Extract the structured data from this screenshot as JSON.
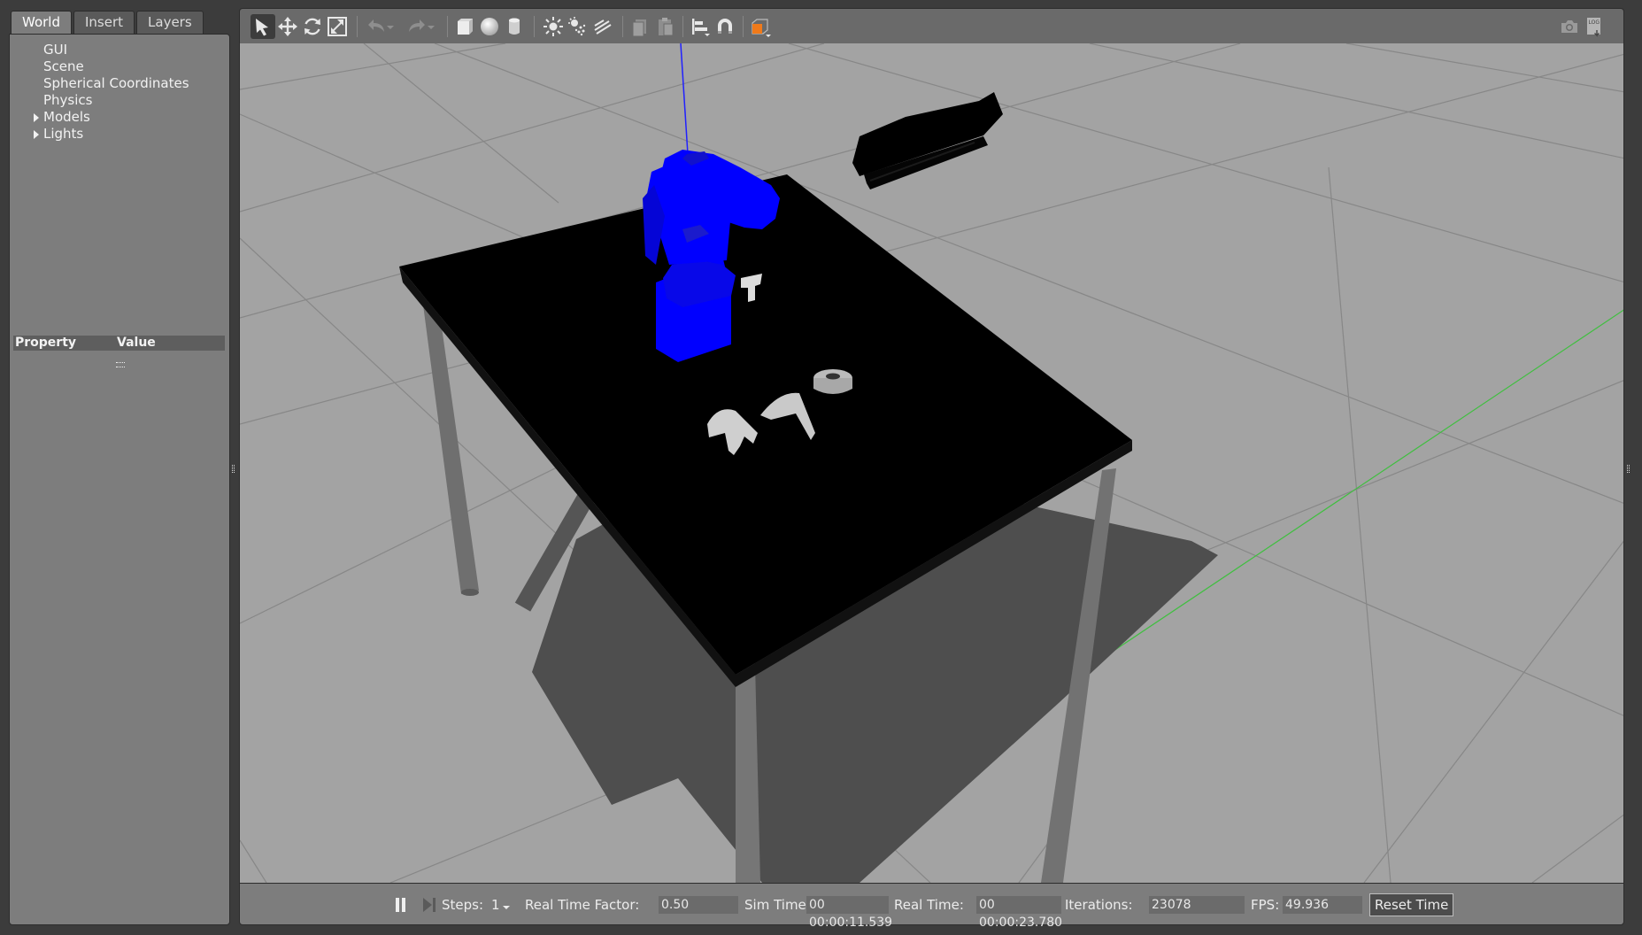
{
  "left_panel": {
    "tabs": [
      "World",
      "Insert",
      "Layers"
    ],
    "active_tab": "World",
    "tree": [
      {
        "label": "GUI",
        "expandable": false
      },
      {
        "label": "Scene",
        "expandable": false
      },
      {
        "label": "Spherical Coordinates",
        "expandable": false
      },
      {
        "label": "Physics",
        "expandable": false
      },
      {
        "label": "Models",
        "expandable": true
      },
      {
        "label": "Lights",
        "expandable": true
      }
    ],
    "properties": {
      "col_property": "Property",
      "col_value": "Value"
    }
  },
  "toolbar": {
    "icons": [
      "select-arrow-icon",
      "translate-icon",
      "rotate-icon",
      "scale-icon",
      "undo-icon",
      "undo-history-icon",
      "redo-icon",
      "redo-history-icon",
      "box-shape-icon",
      "sphere-shape-icon",
      "cylinder-shape-icon",
      "point-light-icon",
      "spot-light-icon",
      "directional-light-icon",
      "copy-icon",
      "paste-icon",
      "align-icon",
      "magnet-snap-icon",
      "view-angle-icon",
      "screenshot-icon",
      "log-icon"
    ],
    "active": "select-arrow-icon"
  },
  "bottom_bar": {
    "steps_label": "Steps:",
    "steps_value": "1",
    "rtf_label": "Real Time Factor:",
    "rtf_value": "0.50",
    "sim_time_label": "Sim Time:",
    "sim_time_value": "00 00:00:11.539",
    "real_time_label": "Real Time:",
    "real_time_value": "00 00:00:23.780",
    "iterations_label": "Iterations:",
    "iterations_value": "23078",
    "fps_label": "FPS:",
    "fps_value": "49.936",
    "reset_label": "Reset Time"
  },
  "colors": {
    "ground": "#a3a3a3",
    "grid": "#8a8a8a",
    "table": "#000000",
    "robot": "#0000ff",
    "toolbar": "#6a6a6a",
    "panel": "#7d7d7d"
  }
}
